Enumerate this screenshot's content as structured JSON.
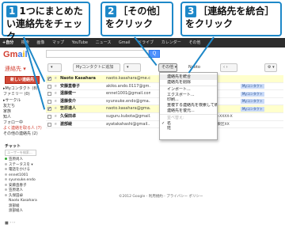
{
  "callouts": [
    {
      "num": "1",
      "text": "1つにまとめたい連絡先をチェック"
    },
    {
      "num": "2",
      "text": "［その他］をクリック"
    },
    {
      "num": "3",
      "text": "［連絡先を統合］をクリック"
    }
  ],
  "topbar": {
    "me": "+自分",
    "items": [
      "検索",
      "画像",
      "マップ",
      "YouTube",
      "ニュース",
      "Gmail",
      "ドライブ",
      "カレンダー",
      "その他"
    ]
  },
  "logo": {
    "g1": "G",
    "g2": "m",
    "g3": "a",
    "g4": "i",
    "g5": "l"
  },
  "search": {
    "button": "Q"
  },
  "contacts_label": "連絡先 ▾",
  "toolbar": {
    "select": "▾",
    "add_to_my_contacts": "Myコンタクトに追加",
    "merge": "▾",
    "other": "その他 ▾",
    "name": "Naoto",
    "nav": "‹   ›",
    "gear": "⚙ ▾"
  },
  "new_contact": "新しい連絡先",
  "sidebar": [
    {
      "label": "▸Myコンタクト (8)",
      "cls": ""
    },
    {
      "label": "ファミリー (0)",
      "cls": ""
    },
    {
      "label": "▸サークル",
      "cls": "hdr"
    },
    {
      "label": "友だち",
      "cls": ""
    },
    {
      "label": "家族",
      "cls": ""
    },
    {
      "label": "知人",
      "cls": ""
    },
    {
      "label": "フォロー中",
      "cls": ""
    },
    {
      "label": "よく連絡を取る人 (7)",
      "cls": "red"
    },
    {
      "label": "その他の連絡先 (2)",
      "cls": ""
    }
  ],
  "chat": {
    "title": "チャット",
    "search_placeholder": "ユーザーを検索...",
    "people": [
      {
        "name": "笠原尚人",
        "status": "green"
      },
      {
        "name": "ステータスを ▾",
        "status": "grey"
      },
      {
        "name": "電話をかける",
        "status": "grey"
      },
      {
        "name": "ennet1001",
        "status": "grey"
      },
      {
        "name": "syunsuke.endo",
        "status": "grey"
      },
      {
        "name": "安藤直春子",
        "status": "grey"
      },
      {
        "name": "笠原達人",
        "status": "grey"
      },
      {
        "name": "久保田卓",
        "status": "grey"
      },
      {
        "name": "Naoto Kasahara",
        "status": "none"
      },
      {
        "name": "渡部綾",
        "status": "none"
      },
      {
        "name": "渡部綾人",
        "status": "none"
      }
    ],
    "bottom": "■ ･･･"
  },
  "contacts": [
    {
      "name": "Naoto Kasahara",
      "email": "naoto.kasahara@me.c...",
      "extra": "",
      "tag": "",
      "checked": true
    },
    {
      "name": "安藤直春子",
      "email": "akiko.ando.0117@gm...",
      "extra": "",
      "tag": "Myコンタクト",
      "checked": false
    },
    {
      "name": "遠藤健一",
      "email": "ennet1001@gmail.com",
      "extra": "",
      "tag": "Myコンタクト",
      "checked": false
    },
    {
      "name": "遠藤俊介",
      "email": "syunsuke.endo@gma...",
      "extra": "",
      "tag": "Myコンタクト",
      "checked": false
    },
    {
      "name": "笠原達人",
      "email": "naoto.kasahara@gma...",
      "extra": "",
      "tag": "Myコンタクト",
      "checked": true
    },
    {
      "name": "久保田卓",
      "email": "suguru.kubota@gmail...",
      "extra": "03-XXXX-X",
      "tag": "",
      "checked": false
    },
    {
      "name": "渡部綾",
      "email": "ayatakahashi@gmail...",
      "extra": "江東区XX",
      "tag": "",
      "checked": false
    }
  ],
  "menu": [
    {
      "label": "連絡先を統合",
      "cls": "hl",
      "chk": ""
    },
    {
      "label": "連絡先を削除",
      "cls": "",
      "chk": ""
    },
    {
      "label": "sep"
    },
    {
      "label": "インポート...",
      "cls": "",
      "chk": ""
    },
    {
      "label": "エクスポート...",
      "cls": "",
      "chk": ""
    },
    {
      "label": "印刷...",
      "cls": "",
      "chk": ""
    },
    {
      "label": "重複する連絡先を検索して統合...",
      "cls": "",
      "chk": ""
    },
    {
      "label": "連絡先を復元...",
      "cls": "",
      "chk": ""
    },
    {
      "label": "sep"
    },
    {
      "label": "並べ替え:",
      "cls": "dim",
      "chk": ""
    },
    {
      "label": "名",
      "cls": "",
      "chk": "✓"
    },
    {
      "label": "姓",
      "cls": "",
      "chk": ""
    }
  ],
  "footer": "©2012 Google - 利用規約 - プライバシー ポリシー"
}
